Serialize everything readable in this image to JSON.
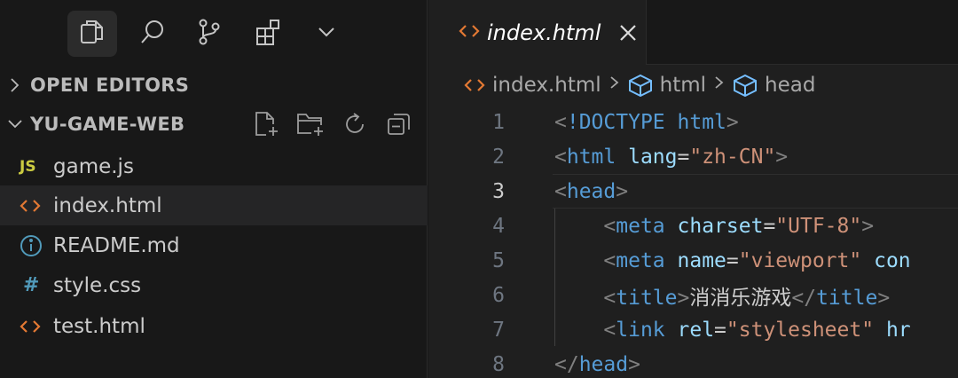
{
  "activity_bar": {
    "items": [
      "explorer-icon",
      "search-icon",
      "source-control-icon",
      "extensions-icon",
      "chevron-down-icon"
    ],
    "active": "explorer-icon"
  },
  "explorer": {
    "open_editors_label": "OPEN EDITORS",
    "project_label": "YU-GAME-WEB",
    "header_actions": [
      "new-file-icon",
      "new-folder-icon",
      "refresh-icon",
      "collapse-all-icon"
    ],
    "files": [
      {
        "name": "game.js",
        "icon": "JS",
        "icon_color": "#cbcb41",
        "selected": false
      },
      {
        "name": "index.html",
        "icon": "<>",
        "icon_color": "#e37933",
        "selected": true
      },
      {
        "name": "README.md",
        "icon": "info",
        "icon_color": "#519aba",
        "selected": false
      },
      {
        "name": "style.css",
        "icon": "#",
        "icon_color": "#519aba",
        "selected": false
      },
      {
        "name": "test.html",
        "icon": "<>",
        "icon_color": "#e37933",
        "selected": false
      }
    ]
  },
  "editor": {
    "tab": {
      "label": "index.html",
      "icon": "html-icon",
      "close": "close-icon"
    },
    "breadcrumb": [
      "index.html",
      "html",
      "head"
    ],
    "current_line": 3,
    "lines": [
      {
        "n": "1",
        "indent": "",
        "parts": [
          [
            "br",
            "<"
          ],
          [
            "tag",
            "!DOCTYPE"
          ],
          [
            "txt",
            " "
          ],
          [
            "tag",
            "html"
          ],
          [
            "br",
            ">"
          ]
        ]
      },
      {
        "n": "2",
        "indent": "",
        "parts": [
          [
            "br",
            "<"
          ],
          [
            "tag",
            "html"
          ],
          [
            "txt",
            " "
          ],
          [
            "attr",
            "lang"
          ],
          [
            "eq",
            "="
          ],
          [
            "str",
            "\"zh-CN\""
          ],
          [
            "br",
            ">"
          ]
        ]
      },
      {
        "n": "3",
        "indent": "",
        "parts": [
          [
            "br",
            "<"
          ],
          [
            "tag",
            "head"
          ],
          [
            "br",
            ">"
          ]
        ]
      },
      {
        "n": "4",
        "indent": "    ",
        "parts": [
          [
            "br",
            "<"
          ],
          [
            "tag",
            "meta"
          ],
          [
            "txt",
            " "
          ],
          [
            "attr",
            "charset"
          ],
          [
            "eq",
            "="
          ],
          [
            "str",
            "\"UTF-8\""
          ],
          [
            "br",
            ">"
          ]
        ]
      },
      {
        "n": "5",
        "indent": "    ",
        "parts": [
          [
            "br",
            "<"
          ],
          [
            "tag",
            "meta"
          ],
          [
            "txt",
            " "
          ],
          [
            "attr",
            "name"
          ],
          [
            "eq",
            "="
          ],
          [
            "str",
            "\"viewport\""
          ],
          [
            "txt",
            " "
          ],
          [
            "attr",
            "con"
          ]
        ]
      },
      {
        "n": "6",
        "indent": "    ",
        "parts": [
          [
            "br",
            "<"
          ],
          [
            "tag",
            "title"
          ],
          [
            "br",
            ">"
          ],
          [
            "txt",
            "消消乐游戏"
          ],
          [
            "br",
            "</"
          ],
          [
            "tag",
            "title"
          ],
          [
            "br",
            ">"
          ]
        ]
      },
      {
        "n": "7",
        "indent": "    ",
        "parts": [
          [
            "br",
            "<"
          ],
          [
            "tag",
            "link"
          ],
          [
            "txt",
            " "
          ],
          [
            "attr",
            "rel"
          ],
          [
            "eq",
            "="
          ],
          [
            "str",
            "\"stylesheet\""
          ],
          [
            "txt",
            " "
          ],
          [
            "attr",
            "hr"
          ]
        ]
      },
      {
        "n": "8",
        "indent": "",
        "parts": [
          [
            "br",
            "</"
          ],
          [
            "tag",
            "head"
          ],
          [
            "br",
            ">"
          ]
        ]
      }
    ]
  }
}
